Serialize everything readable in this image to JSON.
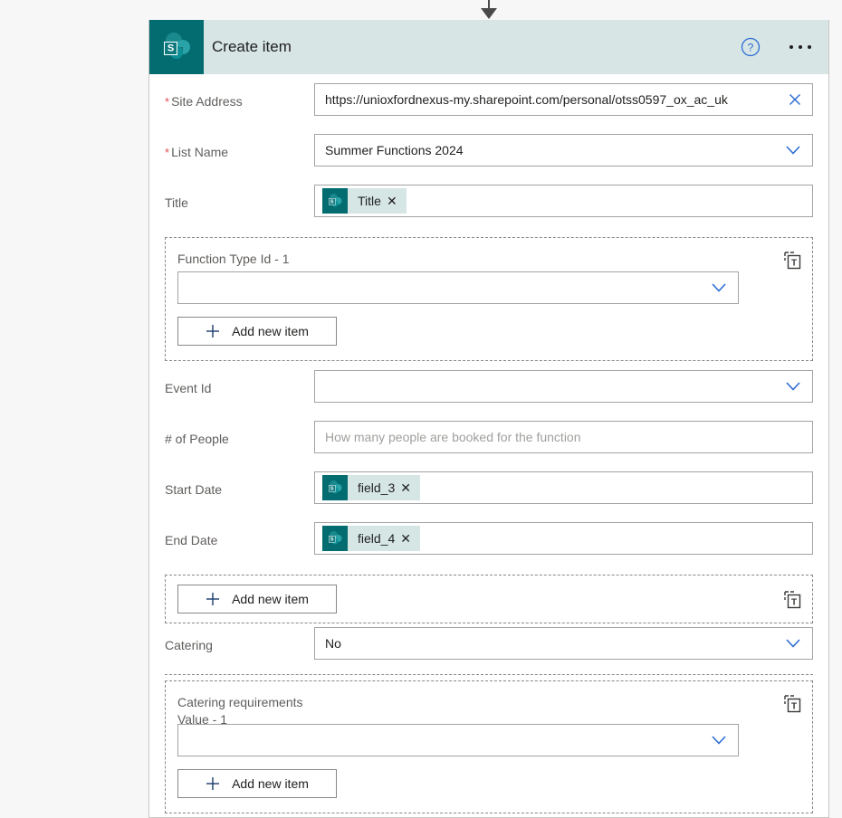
{
  "connector": {
    "icon": "down-arrow-icon"
  },
  "header": {
    "app_icon": "sharepoint-icon",
    "title": "Create item",
    "help_icon": "help-circle-icon",
    "more_icon": "ellipsis-icon",
    "background_color": "#d7e5e5",
    "accent_color": "#036c70"
  },
  "fields": {
    "site_address": {
      "label": "Site Address",
      "required": true,
      "value": "https://unioxfordnexus-my.sharepoint.com/personal/otss0597_ox_ac_uk",
      "clear_icon": "close-icon"
    },
    "list_name": {
      "label": "List Name",
      "required": true,
      "value": "Summer Functions 2024",
      "chevron_icon": "chevron-down-icon"
    },
    "title": {
      "label": "Title",
      "required": false,
      "token": {
        "icon": "sharepoint-icon",
        "text": "Title",
        "remove_icon": "close-icon"
      }
    },
    "function_type_group": {
      "label": "Function Type Id - 1",
      "value": "",
      "chevron_icon": "chevron-down-icon",
      "text_mode_icon": "switch-to-text-mode-icon",
      "add_button": "Add new item",
      "add_icon": "plus-icon"
    },
    "event_id": {
      "label": "Event Id",
      "required": false,
      "value": "",
      "chevron_icon": "chevron-down-icon"
    },
    "num_people": {
      "label": "# of People",
      "required": false,
      "value": "",
      "placeholder": "How many people are booked for the function"
    },
    "start_date": {
      "label": "Start Date",
      "required": false,
      "token": {
        "icon": "sharepoint-icon",
        "text": "field_3",
        "remove_icon": "close-icon"
      }
    },
    "end_date": {
      "label": "End Date",
      "required": false,
      "token": {
        "icon": "sharepoint-icon",
        "text": "field_4",
        "remove_icon": "close-icon"
      }
    },
    "add_item_group": {
      "add_button": "Add new item",
      "add_icon": "plus-icon",
      "text_mode_icon": "switch-to-text-mode-icon"
    },
    "catering": {
      "label": "Catering",
      "required": false,
      "value": "No",
      "chevron_icon": "chevron-down-icon"
    },
    "catering_requirements_group": {
      "label": "Catering requirements",
      "sub_label": "Value - 1",
      "value": "",
      "chevron_icon": "chevron-down-icon",
      "text_mode_icon": "switch-to-text-mode-icon",
      "add_button": "Add new item",
      "add_icon": "plus-icon"
    }
  }
}
